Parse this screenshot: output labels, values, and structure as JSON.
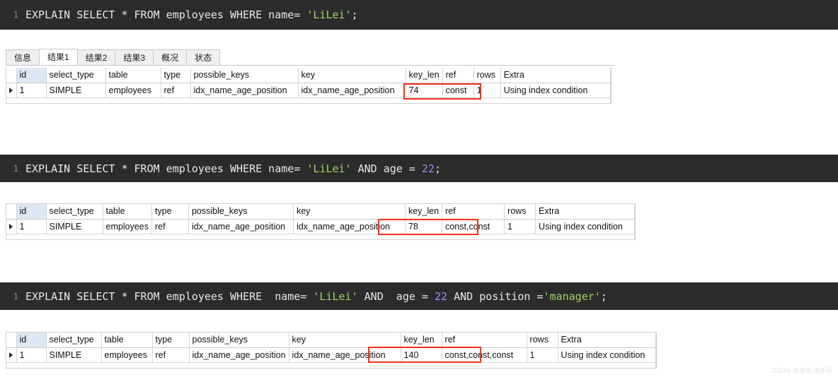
{
  "blocks": [
    {
      "lineno": "1",
      "code_plain": "EXPLAIN SELECT * FROM employees WHERE name= 'LiLei';",
      "prefix": "EXPLAIN SELECT * FROM employees WHERE name= ",
      "string": "'LiLei'",
      "suffix": ";",
      "number": ""
    },
    {
      "lineno": "1",
      "code_plain": "EXPLAIN SELECT * FROM employees WHERE name= 'LiLei' AND age = 22;",
      "prefix": "EXPLAIN SELECT * FROM employees WHERE name= ",
      "string": "'LiLei'",
      "mid": " AND age = ",
      "number": "22",
      "suffix": ";"
    },
    {
      "lineno": "1",
      "code_plain": "EXPLAIN SELECT * FROM employees WHERE  name= 'LiLei' AND  age = 22 AND position ='manager';",
      "prefix": "EXPLAIN SELECT * FROM employees WHERE  name= ",
      "string": "'LiLei'",
      "mid": " AND  age = ",
      "number": "22",
      "mid2": " AND position =",
      "string2": "'manager'",
      "suffix": ";"
    }
  ],
  "tabs": [
    {
      "label": "信息",
      "active": false
    },
    {
      "label": "结果1",
      "active": true
    },
    {
      "label": "结果2",
      "active": false
    },
    {
      "label": "结果3",
      "active": false
    },
    {
      "label": "概况",
      "active": false
    },
    {
      "label": "状态",
      "active": false
    }
  ],
  "grids": [
    {
      "headers": [
        "id",
        "select_type",
        "table",
        "type",
        "possible_keys",
        "key",
        "key_len",
        "ref",
        "rows",
        "Extra"
      ],
      "row": [
        "1",
        "SIMPLE",
        "employees",
        "ref",
        "idx_name_age_position",
        "idx_name_age_position",
        "74",
        "const",
        "1",
        "Using index condition"
      ],
      "highlight_columns": [
        "key_len",
        "ref"
      ]
    },
    {
      "headers": [
        "id",
        "select_type",
        "table",
        "type",
        "possible_keys",
        "key",
        "key_len",
        "ref",
        "rows",
        "Extra"
      ],
      "row": [
        "1",
        "SIMPLE",
        "employees",
        "ref",
        "idx_name_age_position",
        "idx_name_age_position",
        "78",
        "const,const",
        "1",
        "Using index condition"
      ],
      "highlight_columns": [
        "key_len",
        "ref"
      ]
    },
    {
      "headers": [
        "id",
        "select_type",
        "table",
        "type",
        "possible_keys",
        "key",
        "key_len",
        "ref",
        "rows",
        "Extra"
      ],
      "row": [
        "1",
        "SIMPLE",
        "employees",
        "ref",
        "idx_name_age_position",
        "idx_name_age_position",
        "140",
        "const,const,const",
        "1",
        "Using index condition"
      ],
      "highlight_columns": [
        "key_len",
        "ref"
      ]
    }
  ],
  "watermark": "CSDN @亦水诗亦码",
  "colors": {
    "code_background": "#2b2b2b",
    "code_text": "#e8e8e8",
    "string_token": "#9fd35c",
    "number_token": "#a98af7",
    "highlight_border": "#f4301b",
    "id_header_background": "#dce8f5"
  }
}
